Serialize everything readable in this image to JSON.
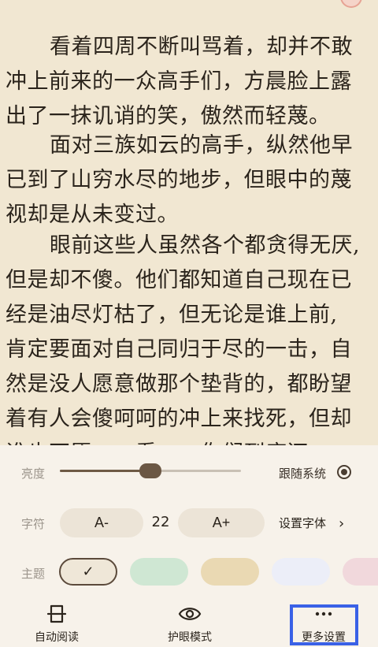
{
  "reader": {
    "paragraphs": [
      {
        "lines": [
          "看着四周不断叫骂着，却并不敢",
          "冲上前来的一众高手们，方晨脸上露",
          "出了一抹讥诮的笑，傲然而轻蔑。"
        ]
      },
      {
        "lines": [
          "面对三族如云的高手，纵然他早",
          "已到了山穷水尽的地步，但眼中的蔑",
          "视却是从未变过。"
        ]
      },
      {
        "lines": [
          "眼前这些人虽然各个都贪得无厌,",
          "但是却不傻。他们都知道自己现在已",
          "经是油尽灯枯了，但无论是谁上前,",
          "肯定要面对自己同归于尽的一击，自",
          "然是没人愿意做那个垫背的，都盼望",
          "着有人会傻呵呵的冲上来找死，但却",
          "谁也不愿……看……你们到底还敢……"
        ]
      }
    ]
  },
  "settings": {
    "brightness": {
      "label": "亮度",
      "level": 0.5,
      "follow_system_label": "跟随系统",
      "follow_system_checked": true
    },
    "font": {
      "label": "字符",
      "decrease_label": "A-",
      "size": "22",
      "increase_label": "A+",
      "set_font_label": "设置字体",
      "chevron": "›"
    },
    "theme": {
      "label": "主题",
      "selected_check": "✓",
      "swatches": [
        {
          "name": "default",
          "color": "#efe7d8",
          "selected": true
        },
        {
          "name": "green",
          "color": "#cfe7d3"
        },
        {
          "name": "yellow",
          "color": "#ead9b3"
        },
        {
          "name": "lavender",
          "color": "#eceef8"
        },
        {
          "name": "pink",
          "color": "#f1d8dc"
        }
      ]
    }
  },
  "bottom_bar": {
    "auto_read": {
      "label": "自动阅读",
      "icon": "auto-read-icon"
    },
    "eye_mode": {
      "label": "护眼模式",
      "icon": "eye-icon"
    },
    "more_settings": {
      "label": "更多设置",
      "icon": "more-dots-icon",
      "highlighted": true
    }
  },
  "colors": {
    "reader_bg": "#f1e7d2",
    "panel_bg": "#f7f2ea",
    "accent": "#6b5744",
    "highlight": "#3a61e6"
  }
}
